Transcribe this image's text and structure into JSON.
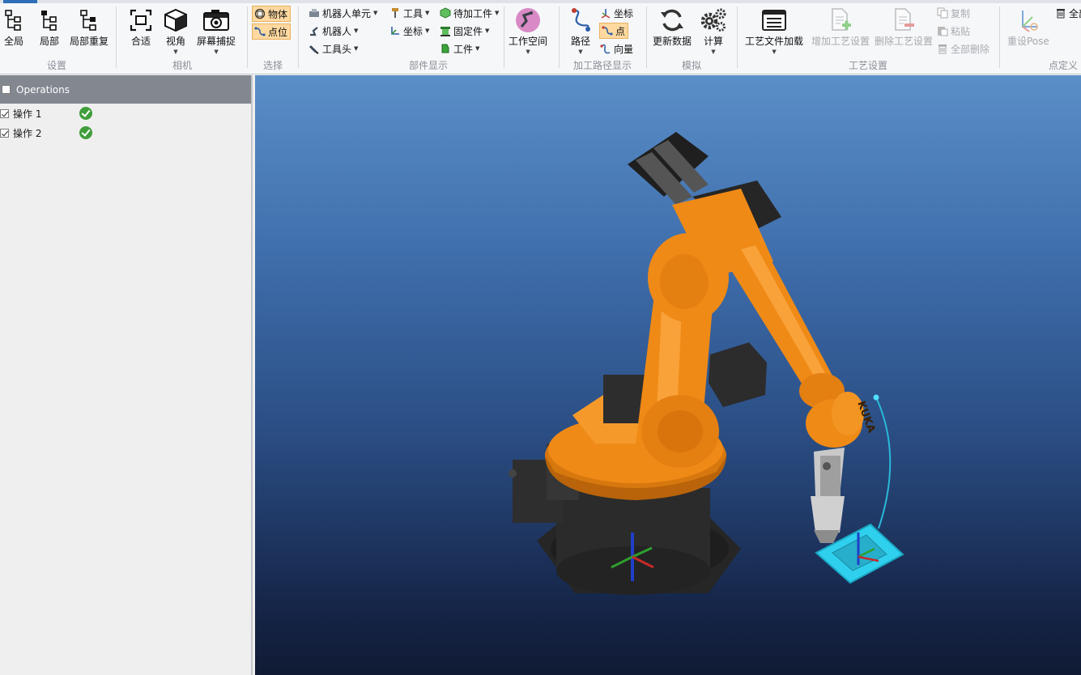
{
  "ribbon": {
    "groups": {
      "settings": "设置",
      "camera": "相机",
      "select": "选择",
      "component_display": "部件显示",
      "path_display": "加工路径显示",
      "simulate": "模拟",
      "process_settings": "工艺设置",
      "point_def": "点定义"
    },
    "settings": {
      "global": "全局",
      "local": "局部",
      "local_repeat": "局部重复"
    },
    "camera": {
      "fit": "合适",
      "view": "视角",
      "screenshot": "屏幕捕捉"
    },
    "select": {
      "object": "物体",
      "point": "点位"
    },
    "components": {
      "robot_cell": "机器人单元",
      "robot": "机器人",
      "tool_head": "工具头",
      "tool": "工具",
      "coordinate": "坐标",
      "pending_workpiece": "待加工件",
      "fixture": "固定件",
      "workpiece": "工件",
      "workspace": "工作空间"
    },
    "path": {
      "path": "路径",
      "coordinate": "坐标",
      "point": "点",
      "vector": "向量"
    },
    "simulate": {
      "update_data": "更新数据",
      "compute": "计算"
    },
    "process": {
      "load_file": "工艺文件加载",
      "add_setting": "增加工艺设置",
      "delete_setting": "删除工艺设置",
      "copy": "复制",
      "paste": "粘贴",
      "delete_all": "全部删除"
    },
    "point_def": {
      "reset_pose": "重设Pose",
      "clear_all_partial": "全部"
    }
  },
  "operations": {
    "header": "Operations",
    "items": [
      {
        "label": "操作 1",
        "checked": true,
        "status": "ok"
      },
      {
        "label": "操作 2",
        "checked": true,
        "status": "ok"
      }
    ]
  },
  "colors": {
    "robot_orange": "#f08a16",
    "robot_dark": "#2a2a2a",
    "workpiece_cyan": "#2fd0ee",
    "selected_btn": "#ffd9a0"
  }
}
